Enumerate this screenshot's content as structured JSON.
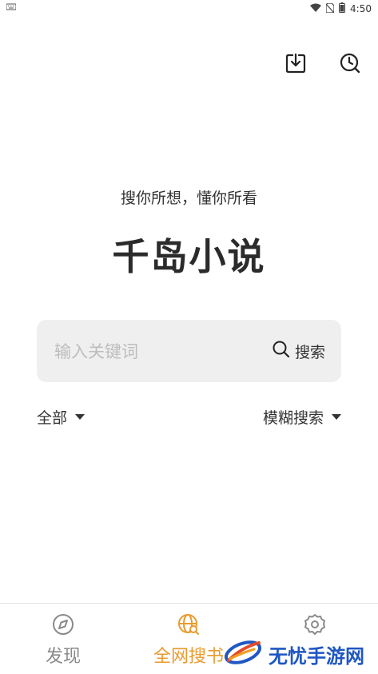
{
  "status_bar": {
    "time": "4:50",
    "left_icon": "keyboard-icon",
    "icons": [
      "wifi-icon",
      "no-sim-icon",
      "battery-icon"
    ]
  },
  "top_actions": {
    "icons": [
      "download-icon",
      "history-icon"
    ]
  },
  "slogan": "搜你所想，懂你所看",
  "app_title": "千岛小说",
  "search": {
    "placeholder": "输入关键词",
    "value": "",
    "button_label": "搜索",
    "button_icon": "search-icon"
  },
  "filters": {
    "scope_label": "全部",
    "mode_label": "模糊搜索"
  },
  "bottom_nav": {
    "items": [
      {
        "label": "发现",
        "icon": "compass-icon",
        "active": false
      },
      {
        "label": "全网搜书",
        "icon": "globe-search-icon",
        "active": true
      },
      {
        "label": "",
        "icon": "gear-icon",
        "active": false
      }
    ]
  },
  "watermark": {
    "text": "无忧手游网"
  },
  "colors": {
    "accent": "#e89b2e",
    "inactive": "#8a8a8a",
    "search_bg": "#efefef",
    "watermark_blue": "#1f57c3"
  }
}
